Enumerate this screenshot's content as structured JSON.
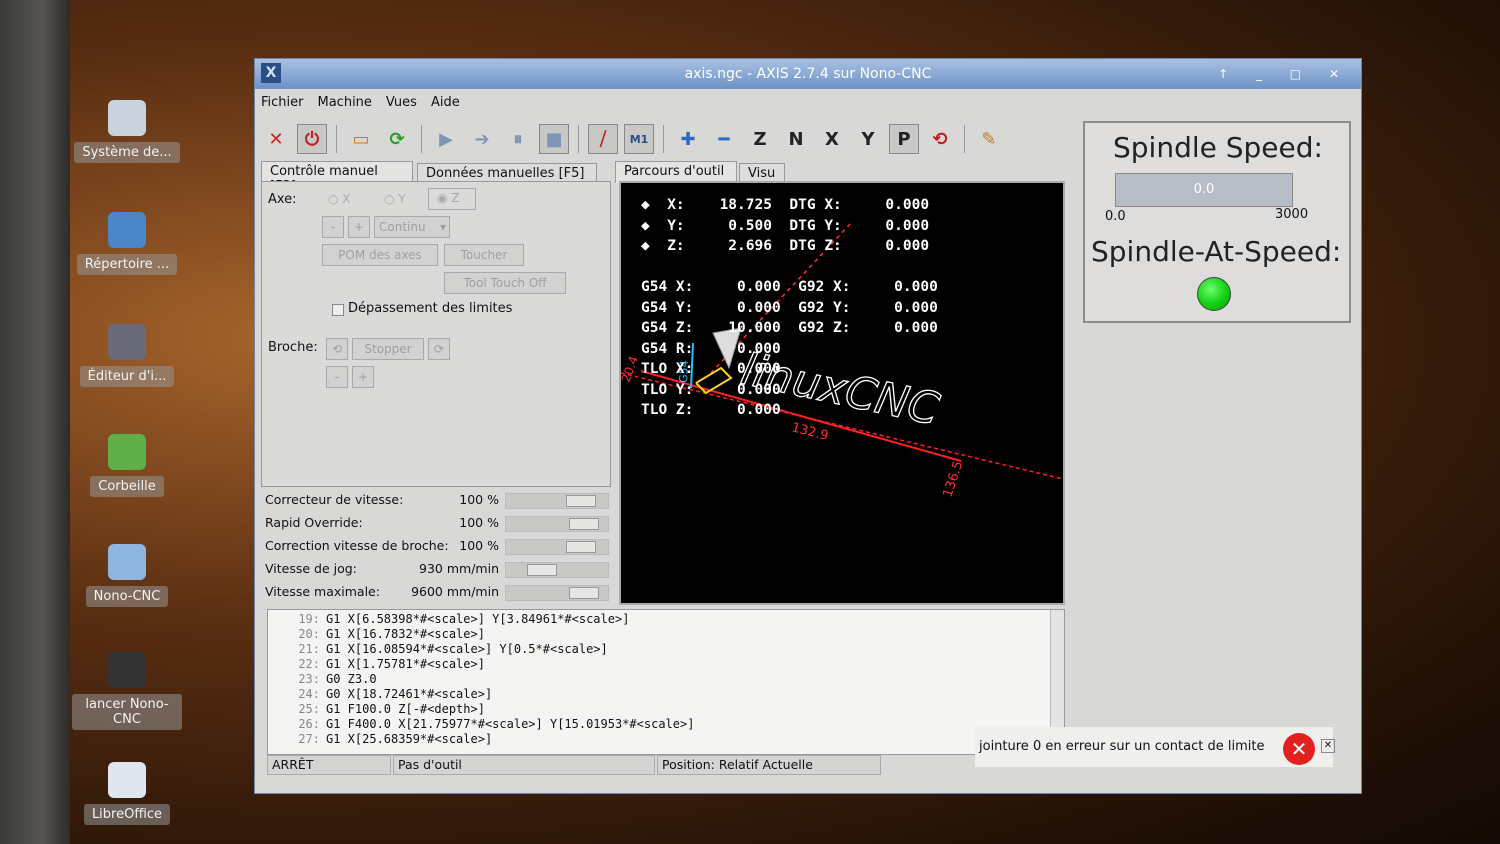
{
  "desktop": {
    "icons": [
      {
        "label": "Système de...",
        "color": "#c9d3de"
      },
      {
        "label": "Répertoire ...",
        "color": "#4a86c8"
      },
      {
        "label": "Éditeur d'i...",
        "color": "#6a6a7a"
      },
      {
        "label": "Corbeille",
        "color": "#5fae4a"
      },
      {
        "label": "Nono-CNC",
        "color": "#8fb6e0"
      },
      {
        "label": "lancer Nono-CNC",
        "color": "#333333"
      },
      {
        "label": "LibreOffice",
        "color": "#dfe6ee"
      }
    ]
  },
  "window": {
    "title": "axis.ngc - AXIS 2.7.4 sur Nono-CNC",
    "logo": "X",
    "controls": "↑ _ □ ✕"
  },
  "menu": [
    "Fichier",
    "Machine",
    "Vues",
    "Aide"
  ],
  "toolbar": [
    {
      "name": "estop-icon",
      "glyph": "✕",
      "color": "#d02020"
    },
    {
      "name": "power-icon",
      "glyph": "⏻",
      "color": "#c02020",
      "pressed": true
    },
    {
      "sep": true
    },
    {
      "name": "open-file-icon",
      "glyph": "▭",
      "color": "#c87a20"
    },
    {
      "name": "reload-icon",
      "glyph": "⟳",
      "color": "#2a9a2a"
    },
    {
      "sep": true
    },
    {
      "name": "run-icon",
      "glyph": "▶",
      "color": "#7e95b5"
    },
    {
      "name": "step-icon",
      "glyph": "➔",
      "color": "#7e95b5"
    },
    {
      "name": "pause-icon",
      "glyph": "⏸",
      "color": "#7e95b5"
    },
    {
      "name": "stop-icon",
      "glyph": "■",
      "color": "#7e95b5",
      "pressed": true
    },
    {
      "sep": true
    },
    {
      "name": "block-delete-icon",
      "glyph": "⧸",
      "color": "#c02020",
      "pressed": true
    },
    {
      "name": "optional-stop-icon",
      "glyph": "M1",
      "color": "#2a4e86",
      "pressed": true
    },
    {
      "sep": true
    },
    {
      "name": "zoom-in-icon",
      "glyph": "✚",
      "color": "#2a6ac8"
    },
    {
      "name": "zoom-out-icon",
      "glyph": "━",
      "color": "#2a6ac8"
    },
    {
      "name": "view-z-icon",
      "glyph": "Z",
      "color": "#222"
    },
    {
      "name": "view-z2-icon",
      "glyph": "N",
      "color": "#222"
    },
    {
      "name": "view-x-icon",
      "glyph": "X",
      "color": "#222"
    },
    {
      "name": "view-y-icon",
      "glyph": "Y",
      "color": "#222"
    },
    {
      "name": "view-p-icon",
      "glyph": "P",
      "color": "#222",
      "pressed": true
    },
    {
      "name": "rotate-icon",
      "glyph": "⟲",
      "color": "#c02020"
    },
    {
      "sep": true
    },
    {
      "name": "clear-plot-icon",
      "glyph": "✎",
      "color": "#c87a20"
    }
  ],
  "tabs_left": [
    "Contrôle manuel [F3]",
    "Données manuelles [F5]"
  ],
  "tabs_right": [
    "Parcours d'outil",
    "Visu"
  ],
  "manual": {
    "axe_label": "Axe:",
    "axes": [
      "X",
      "Y",
      "Z"
    ],
    "jog_minus": "-",
    "jog_plus": "+",
    "jog_mode": "Continu",
    "home_btn": "POM des axes",
    "touch_btn": "Toucher",
    "tool_touch_btn": "Tool Touch Off",
    "override_limits": "Dépassement des limites",
    "broche_label": "Broche:",
    "stop_btn": "Stopper"
  },
  "sliders": [
    {
      "name": "Correcteur de vitesse:",
      "value": "100 %",
      "pos": 0.85
    },
    {
      "name": "Rapid Override:",
      "value": "100 %",
      "pos": 0.9
    },
    {
      "name": "Correction vitesse de broche:",
      "value": "100 %",
      "pos": 0.85
    },
    {
      "name": "Vitesse de jog:",
      "value": "930 mm/min",
      "pos": 0.3
    },
    {
      "name": "Vitesse maximale:",
      "value": "9600 mm/min",
      "pos": 0.9
    }
  ],
  "dro": [
    "◆  X:    18.725  DTG X:     0.000",
    "◆  Y:     0.500  DTG Y:     0.000",
    "◆  Z:     2.696  DTG Z:     0.000",
    "",
    "G54 X:     0.000  G92 X:     0.000",
    "G54 Y:     0.000  G92 Y:     0.000",
    "G54 Z:    10.000  G92 Z:     0.000",
    "G54 R:     0.000",
    "TLO X:     0.000",
    "TLO Y:     0.000",
    "TLO Z:     0.000"
  ],
  "preview": {
    "logo_text": "linuxCNC",
    "dim_x": "132.9",
    "dim_y": "136.5",
    "dim_z": "20.4",
    "axis_label": "G54"
  },
  "spindle": {
    "title": "Spindle Speed:",
    "bar_value": "0.0",
    "bar_fraction": 0,
    "min": "0.0",
    "max": "3000",
    "at_speed": "Spindle-At-Speed:",
    "led_color": "#12d012"
  },
  "gcode": [
    {
      "n": "19:",
      "t": "G1 X[6.58398*#<scale>] Y[3.84961*#<scale>]"
    },
    {
      "n": "20:",
      "t": "G1 X[16.7832*#<scale>]"
    },
    {
      "n": "21:",
      "t": "G1 X[16.08594*#<scale>] Y[0.5*#<scale>]"
    },
    {
      "n": "22:",
      "t": "G1 X[1.75781*#<scale>]"
    },
    {
      "n": "23:",
      "t": "G0 Z3.0"
    },
    {
      "n": "24:",
      "t": "G0 X[18.72461*#<scale>]"
    },
    {
      "n": "25:",
      "t": "G1 F100.0 Z[-#<depth>]"
    },
    {
      "n": "26:",
      "t": "G1 F400.0 X[21.75977*#<scale>] Y[15.01953*#<scale>]"
    },
    {
      "n": "27:",
      "t": "G1 X[25.68359*#<scale>]"
    }
  ],
  "status": {
    "state": "ARRÊT",
    "tool": "Pas d'outil",
    "position": "Position: Relatif Actuelle"
  },
  "error": {
    "message": "jointure 0 en erreur sur un contact de limite",
    "close": "✕"
  }
}
